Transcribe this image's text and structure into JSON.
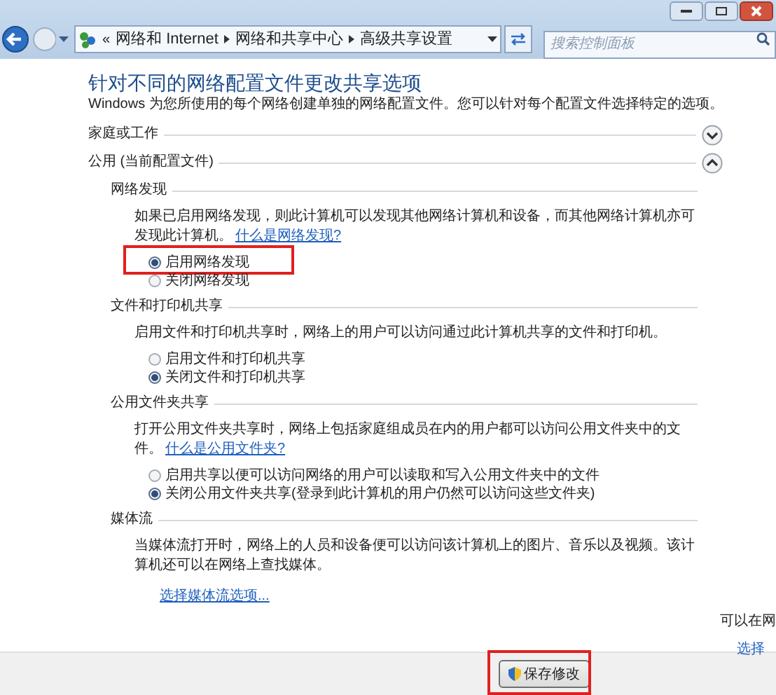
{
  "address_bar": {
    "breadcrumbs": [
      "网络和 Internet",
      "网络和共享中心",
      "高级共享设置"
    ],
    "overflow": "«"
  },
  "search": {
    "placeholder": "搜索控制面板"
  },
  "heading": "针对不同的网络配置文件更改共享选项",
  "intro": "Windows 为您所使用的每个网络创建单独的网络配置文件。您可以针对每个配置文件选择特定的选项。",
  "profiles": [
    {
      "title": "家庭或工作",
      "expanded": false
    },
    {
      "title": "公用 (当前配置文件)",
      "expanded": true
    }
  ],
  "sections": [
    {
      "title": "网络发现",
      "description": "如果已启用网络发现，则此计算机可以发现其他网络计算机和设备，而其他网络计算机亦可发现此计算机。",
      "link": "什么是网络发现?",
      "options": [
        {
          "label": "启用网络发现",
          "selected": true,
          "highlighted": true
        },
        {
          "label": "关闭网络发现",
          "selected": false,
          "highlighted": false
        }
      ]
    },
    {
      "title": "文件和打印机共享",
      "description": "启用文件和打印机共享时，网络上的用户可以访问通过此计算机共享的文件和打印机。",
      "options": [
        {
          "label": "启用文件和打印机共享",
          "selected": false,
          "highlighted": false
        },
        {
          "label": "关闭文件和打印机共享",
          "selected": true,
          "highlighted": false
        }
      ]
    },
    {
      "title": "公用文件夹共享",
      "description": "打开公用文件夹共享时，网络上包括家庭组成员在内的用户都可以访问公用文件夹中的文件。",
      "link": "什么是公用文件夹?",
      "options": [
        {
          "label": "启用共享以便可以访问网络的用户可以读取和写入公用文件夹中的文件",
          "selected": false,
          "highlighted": false
        },
        {
          "label": "关闭公用文件夹共享(登录到此计算机的用户仍然可以访问这些文件夹)",
          "selected": true,
          "highlighted": false
        }
      ]
    },
    {
      "title": "媒体流",
      "description": "当媒体流打开时，网络上的人员和设备便可以访问该计算机上的图片、音乐以及视频。该计算机还可以在网络上查找媒体。",
      "link_below": "选择媒体流选项..."
    }
  ],
  "save_button": {
    "label": "保存修改",
    "highlighted": true
  },
  "background_fragments": [
    "可以在网",
    "选择"
  ]
}
